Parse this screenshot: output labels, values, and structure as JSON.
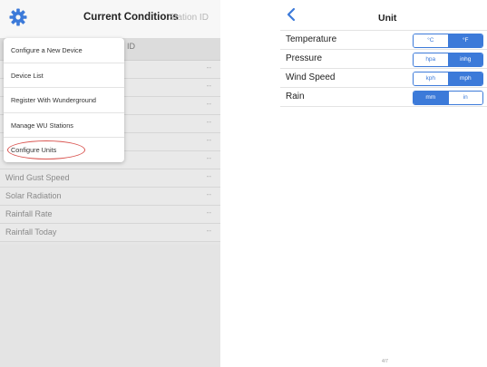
{
  "left": {
    "title": "Current Conditions",
    "station_label": "Station ID",
    "subheader_text": "ID",
    "menu": [
      {
        "label": "Configure a New Device"
      },
      {
        "label": "Device List"
      },
      {
        "label": "Register With Wunderground"
      },
      {
        "label": "Manage WU Stations"
      },
      {
        "label": "Configure Units",
        "highlighted": true
      }
    ],
    "rows": [
      {
        "label": "",
        "value": "--"
      },
      {
        "label": "",
        "value": "--"
      },
      {
        "label": "",
        "value": "--"
      },
      {
        "label": "",
        "value": "--"
      },
      {
        "label": "",
        "value": "--"
      },
      {
        "label": "",
        "value": "--"
      },
      {
        "label": "Wind Gust Speed",
        "value": "--"
      },
      {
        "label": "Solar Radiation",
        "value": "--"
      },
      {
        "label": "Rainfall Rate",
        "value": "--"
      },
      {
        "label": "Rainfall Today",
        "value": "--"
      }
    ]
  },
  "right": {
    "title": "Unit",
    "rows": [
      {
        "label": "Temperature",
        "options": [
          "°C",
          "°F"
        ],
        "selected": 1
      },
      {
        "label": "Pressure",
        "options": [
          "hpa",
          "inhg"
        ],
        "selected": 1
      },
      {
        "label": "Wind Speed",
        "options": [
          "kph",
          "mph"
        ],
        "selected": 1
      },
      {
        "label": "Rain",
        "options": [
          "mm",
          "in"
        ],
        "selected": 0
      }
    ],
    "page_number": "4/7"
  },
  "colors": {
    "accent": "#3c7ad9",
    "highlight_circle": "#d9534f"
  }
}
